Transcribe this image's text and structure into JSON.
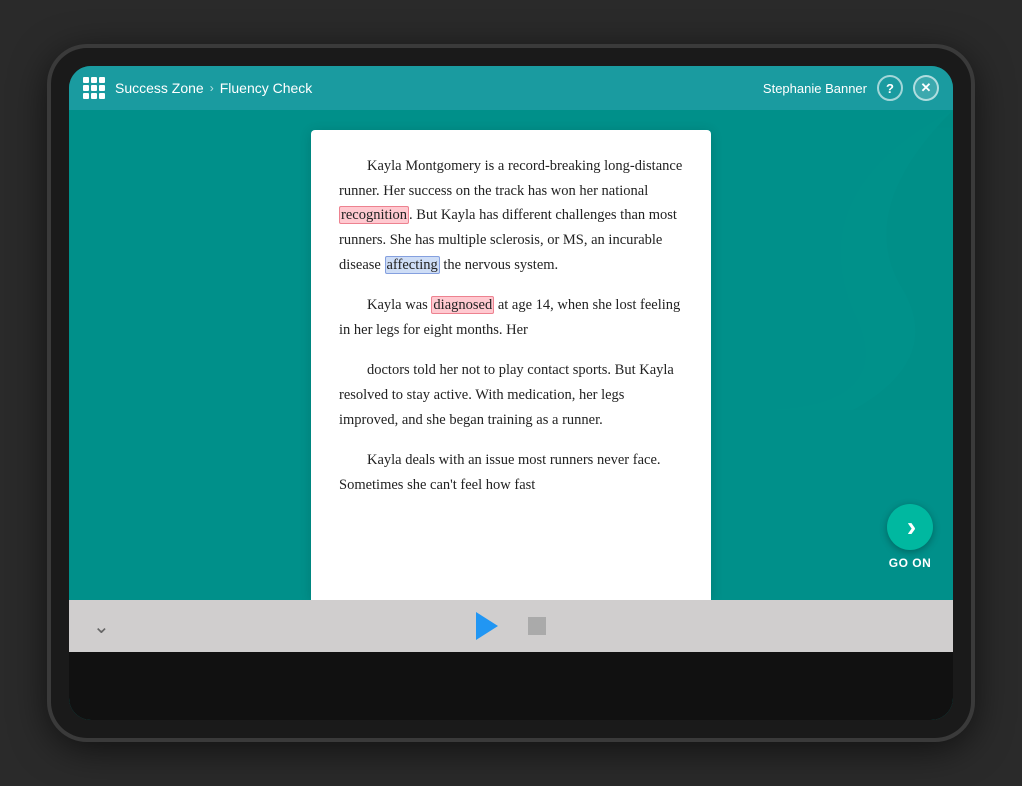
{
  "header": {
    "grid_icon_label": "apps",
    "breadcrumb": {
      "parent": "Success Zone",
      "separator": "›",
      "current": "Fluency Check"
    },
    "user_name": "Stephanie Banner",
    "help_label": "?",
    "close_label": "✕"
  },
  "reading": {
    "paragraphs": [
      {
        "id": "p1",
        "text_before": "Kayla Montgomery is a record-breaking long-distance runner. Her success on the track has won her national ",
        "highlight1": {
          "text": "recognition",
          "type": "pink"
        },
        "text_after": ". But Kayla has different challenges than most runners. She has multiple sclerosis, or MS, an incurable disease ",
        "highlight2": {
          "text": "affecting",
          "type": "blue"
        },
        "text_end": " the nervous system."
      },
      {
        "id": "p2",
        "text_before": "Kayla was ",
        "highlight1": {
          "text": "diagnosed",
          "type": "pink"
        },
        "text_after": " at age 14, when she lost feeling in her legs for eight months. Her"
      },
      {
        "id": "p3",
        "text": "doctors told her not to play contact sports. But Kayla resolved to stay active. With medication, her legs improved, and she began training as a runner."
      },
      {
        "id": "p4",
        "text": "Kayla deals with an issue most runners never face. Sometimes she can't feel how fast"
      }
    ]
  },
  "go_on": {
    "label": "GO ON"
  },
  "controls": {
    "chevron": "˅",
    "play_label": "play",
    "stop_label": "stop"
  }
}
